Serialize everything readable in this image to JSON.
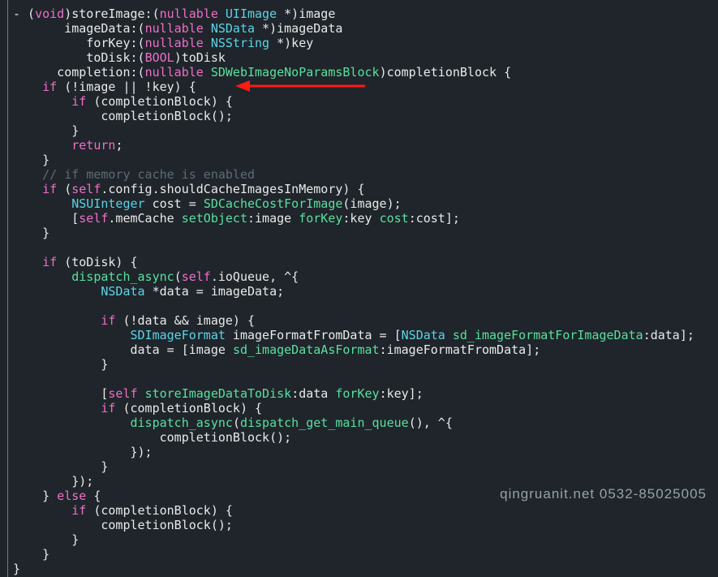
{
  "code": {
    "l01a": "- (",
    "l01_void": "void",
    "l01b": ")storeImage:(",
    "l01_nullable": "nullable",
    "l01c": " ",
    "l01_UIImage": "UIImage",
    "l01d": " *)image",
    "l02a": "       imageData:(",
    "l02_nullable": "nullable",
    "l02b": " ",
    "l02_NSData": "NSData",
    "l02c": " *)imageData",
    "l03a": "          forKey:(",
    "l03_nullable": "nullable",
    "l03b": " ",
    "l03_NSString": "NSString",
    "l03c": " *)key",
    "l04a": "          toDisk:(",
    "l04_BOOL": "BOOL",
    "l04b": ")toDisk",
    "l05a": "      completion:(",
    "l05_nullable": "nullable",
    "l05b": " ",
    "l05_Block": "SDWebImageNoParamsBlock",
    "l05c": ")completionBlock {",
    "l06a": "    ",
    "l06_if": "if",
    "l06b": " (!image || !key) {",
    "l07a": "        ",
    "l07_if": "if",
    "l07b": " (completionBlock) {",
    "l08a": "            completionBlock();",
    "l09a": "        }",
    "l10a": "        ",
    "l10_return": "return",
    "l10b": ";",
    "l11a": "    }",
    "l12a": "    ",
    "l12_cm": "// if memory cache is enabled",
    "l13a": "    ",
    "l13_if": "if",
    "l13b": " (",
    "l13_self": "self",
    "l13c": ".config.shouldCacheImagesInMemory) {",
    "l14a": "        ",
    "l14_NSUInteger": "NSUInteger",
    "l14b": " cost = ",
    "l14_fn": "SDCacheCostForImage",
    "l14c": "(image);",
    "l15a": "        [",
    "l15_self": "self",
    "l15b": ".memCache ",
    "l15_set": "setObject",
    "l15c": ":image ",
    "l15_forKey": "forKey",
    "l15d": ":key ",
    "l15_cost": "cost",
    "l15e": ":cost];",
    "l16a": "    }",
    "l17a": "",
    "l18a": "    ",
    "l18_if": "if",
    "l18b": " (toDisk) {",
    "l19a": "        ",
    "l19_fn": "dispatch_async",
    "l19b": "(",
    "l19_self": "self",
    "l19c": ".ioQueue, ^{",
    "l20a": "            ",
    "l20_NSData": "NSData",
    "l20b": " *data = imageData;",
    "l21a": "",
    "l22a": "            ",
    "l22_if": "if",
    "l22b": " (!data && image) {",
    "l23a": "                ",
    "l23_type": "SDImageFormat",
    "l23b": " imageFormatFromData = [",
    "l23_NSData": "NSData",
    "l23c": " ",
    "l23_fn": "sd_imageFormatForImageData",
    "l23d": ":data];",
    "l24a": "                data = [image ",
    "l24_fn": "sd_imageDataAsFormat",
    "l24b": ":imageFormatFromData];",
    "l25a": "            }",
    "l26a": "",
    "l27a": "            [",
    "l27_self": "self",
    "l27b": " ",
    "l27_fn": "storeImageDataToDisk",
    "l27c": ":data ",
    "l27_forKey": "forKey",
    "l27d": ":key];",
    "l28a": "            ",
    "l28_if": "if",
    "l28b": " (completionBlock) {",
    "l29a": "                ",
    "l29_fn": "dispatch_async",
    "l29b": "(",
    "l29_fn2": "dispatch_get_main_queue",
    "l29c": "(), ^{",
    "l30a": "                    completionBlock();",
    "l31a": "                });",
    "l32a": "            }",
    "l33a": "        });",
    "l34a": "    } ",
    "l34_else": "else",
    "l34b": " {",
    "l35a": "        ",
    "l35_if": "if",
    "l35b": " (completionBlock) {",
    "l36a": "            completionBlock();",
    "l37a": "        }",
    "l38a": "    }",
    "l39a": "}"
  },
  "watermark": "qingruanit.net 0532-85025005"
}
